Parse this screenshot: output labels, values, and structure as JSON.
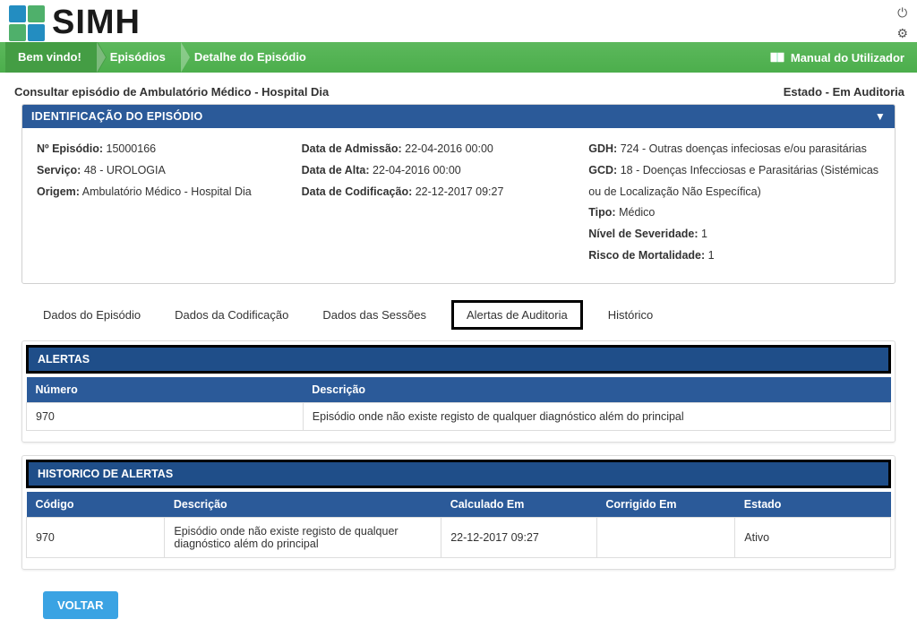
{
  "brand": "SIMH",
  "top_icons": {
    "power": "⏻",
    "settings": "⚙"
  },
  "breadcrumb": {
    "welcome": "Bem vindo!",
    "episodes": "Episódios",
    "detail": "Detalhe do Episódio"
  },
  "manual_label": "Manual do Utilizador",
  "page_title": "Consultar episódio de Ambulatório Médico - Hospital Dia",
  "state_label": "Estado - Em Auditoria",
  "identification": {
    "header": "IDENTIFICAÇÃO DO EPISÓDIO",
    "rows": {
      "episodio_lbl": "Nº Episódio:",
      "episodio_val": "15000166",
      "servico_lbl": "Serviço:",
      "servico_val": "48 - UROLOGIA",
      "origem_lbl": "Origem:",
      "origem_val": "Ambulatório Médico - Hospital Dia",
      "admissao_lbl": "Data de Admissão:",
      "admissao_val": "22-04-2016 00:00",
      "alta_lbl": "Data de Alta:",
      "alta_val": "22-04-2016 00:00",
      "codif_lbl": "Data de Codificação:",
      "codif_val": "22-12-2017 09:27",
      "gdh_lbl": "GDH:",
      "gdh_val": "724 - Outras doenças infeciosas e/ou parasitárias",
      "gcd_lbl": "GCD:",
      "gcd_val": "18 - Doenças Infecciosas e Parasitárias (Sistémicas ou de Localização Não Específica)",
      "tipo_lbl": "Tipo:",
      "tipo_val": "Médico",
      "sev_lbl": "Nível de Severidade:",
      "sev_val": "1",
      "mort_lbl": "Risco de Mortalidade:",
      "mort_val": "1"
    }
  },
  "tabs": {
    "t1": "Dados do Episódio",
    "t2": "Dados da Codificação",
    "t3": "Dados das Sessões",
    "t4": "Alertas de Auditoria",
    "t5": "Histórico"
  },
  "alerts": {
    "header": "ALERTAS",
    "cols": {
      "numero": "Número",
      "descricao": "Descrição"
    },
    "rows": [
      {
        "numero": "970",
        "descricao": "Episódio onde não existe registo de qualquer diagnóstico além do principal"
      }
    ]
  },
  "history": {
    "header": "HISTORICO DE ALERTAS",
    "cols": {
      "codigo": "Código",
      "descricao": "Descrição",
      "calc": "Calculado Em",
      "corr": "Corrigido Em",
      "estado": "Estado"
    },
    "rows": [
      {
        "codigo": "970",
        "descricao": "Episódio onde não existe registo de qualquer diagnóstico além do principal",
        "calc": "22-12-2017 09:27",
        "corr": "",
        "estado": "Ativo"
      }
    ]
  },
  "back_button": "VOLTAR"
}
